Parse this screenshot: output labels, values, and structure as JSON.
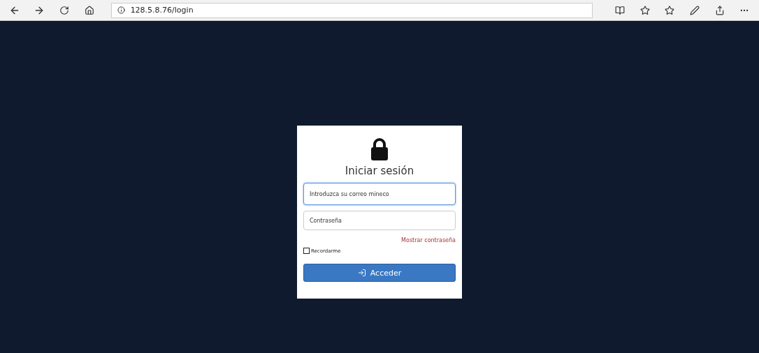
{
  "browser": {
    "address": "128.5.8.76/login"
  },
  "login": {
    "title": "Iniciar sesión",
    "fields": [
      {
        "placeholder": "Introduzca su correo mineco",
        "focused": true
      },
      {
        "placeholder": "Contraseña",
        "focused": false
      }
    ],
    "show_password": "Mostrar contraseña",
    "remember": {
      "label": "Recordarme",
      "checked": false
    },
    "submit": "Acceder"
  }
}
